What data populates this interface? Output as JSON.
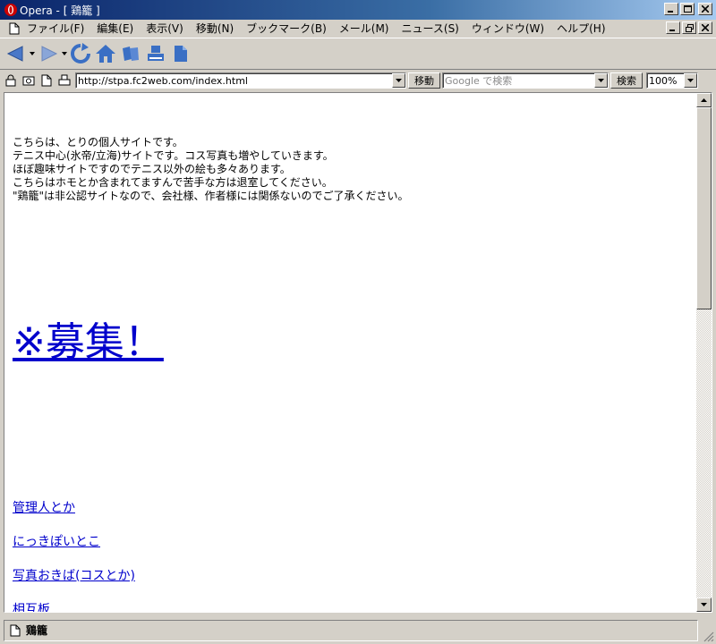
{
  "window": {
    "title": "Opera - [ 鶏籠 ]"
  },
  "menu": {
    "items": [
      "ファイル(F)",
      "編集(E)",
      "表示(V)",
      "移動(N)",
      "ブックマーク(B)",
      "メール(M)",
      "ニュース(S)",
      "ウィンドウ(W)",
      "ヘルプ(H)"
    ]
  },
  "toolbar": {
    "icons": [
      "back-icon",
      "forward-icon",
      "reload-icon",
      "home-icon",
      "bookmarks-icon",
      "print-icon",
      "page-icon"
    ]
  },
  "address": {
    "url": "http://stpa.fc2web.com/index.html",
    "go_label": "移動",
    "search_placeholder": "Google で検索",
    "search_label": "検索",
    "zoom": "100%"
  },
  "page": {
    "intro_lines": [
      "こちらは、とりの個人サイトです。",
      "テニス中心(氷帝/立海)サイトです。コス写真も増やしていきます。",
      "ほぼ趣味サイトですのでテニス以外の絵も多々あります。",
      "こちらはホモとか含まれてますんで苦手な方は退室してください。",
      "\"鶏籠\"は非公認サイトなので、会社様、作者様には関係ないのでご了承ください。"
    ],
    "big_link": "※募集！",
    "links": [
      "管理人とか",
      "にっきぽいとこ",
      "写真おきば(コスとか)",
      "相互板"
    ]
  },
  "status": {
    "text": "鶏籠"
  },
  "colors": {
    "link": "#0000cc",
    "titlebar": "#0a246a",
    "chrome": "#d4d0c8"
  }
}
